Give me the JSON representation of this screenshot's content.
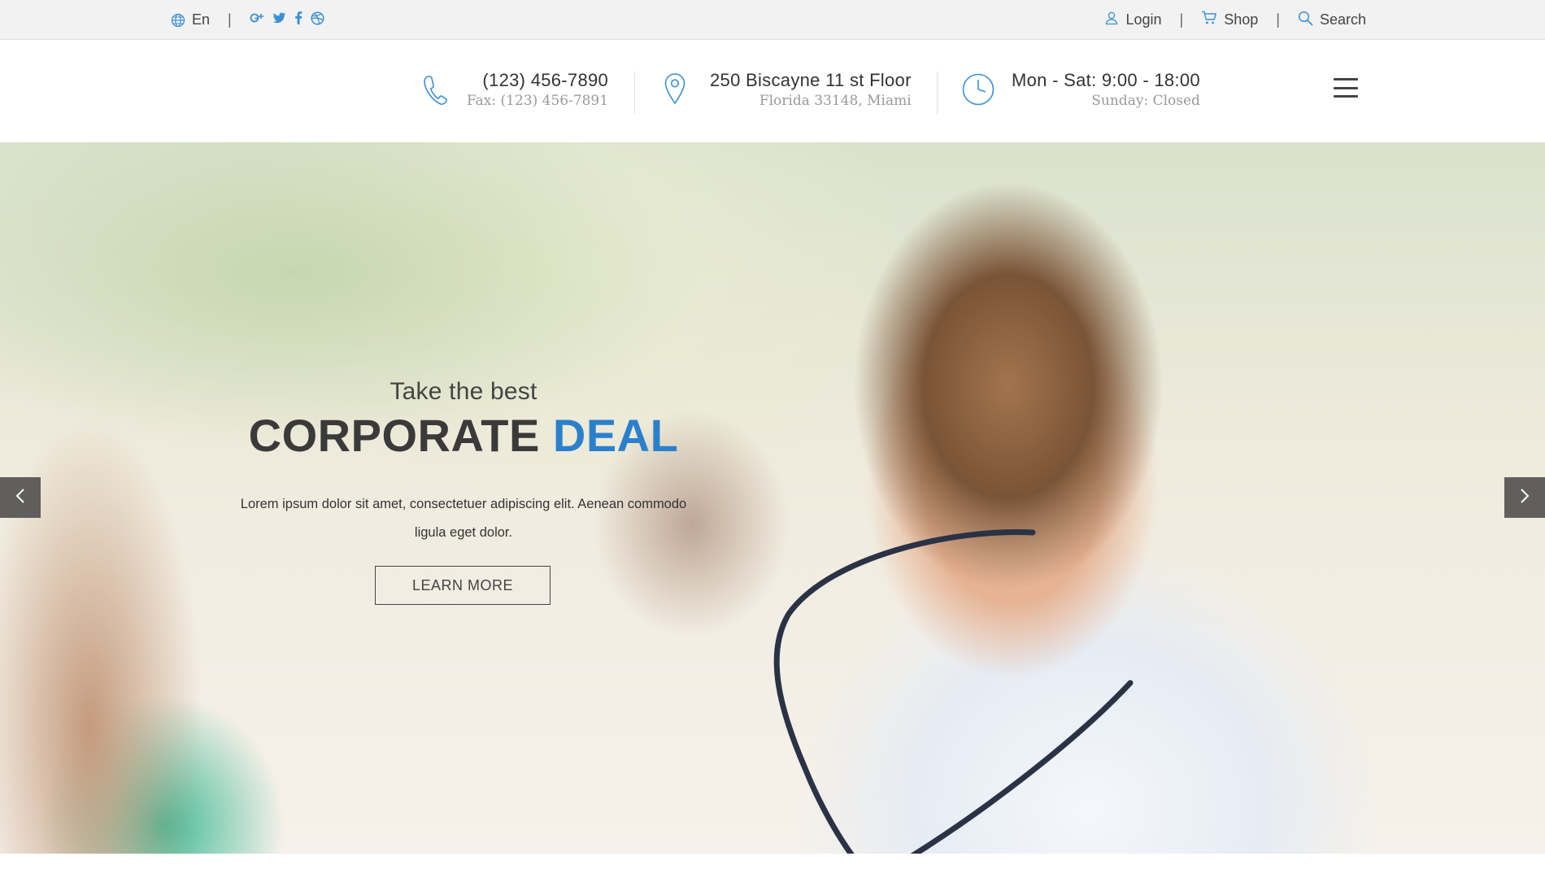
{
  "topbar": {
    "language": "En",
    "separator": "|",
    "social_icons": [
      "google-plus-icon",
      "twitter-icon",
      "facebook-icon",
      "dribbble-icon"
    ],
    "login_label": "Login",
    "shop_label": "Shop",
    "search_label": "Search"
  },
  "header": {
    "phone": {
      "main": "(123) 456-7890",
      "sub": "Fax: (123) 456-7891",
      "icon": "phone-icon"
    },
    "address": {
      "main": "250 Biscayne 11 st Floor",
      "sub": "Florida 33148, Miami",
      "icon": "map-pin-icon"
    },
    "hours": {
      "main": "Mon - Sat: 9:00 - 18:00",
      "sub": "Sunday: Closed",
      "icon": "clock-icon"
    },
    "menu_icon": "hamburger-menu-icon"
  },
  "hero": {
    "subtitle": "Take the best",
    "title_main": "CORPORATE",
    "title_accent": "DEAL",
    "description": "Lorem ipsum dolor sit amet, consectetuer adipiscing elit. Aenean commodo ligula eget dolor.",
    "button_label": "LEARN MORE",
    "prev_icon": "chevron-left-icon",
    "next_icon": "chevron-right-icon"
  },
  "colors": {
    "accent": "#2b80cc",
    "topbar_bg": "#f2f2f2",
    "icon_blue": "#3a8fd6"
  }
}
